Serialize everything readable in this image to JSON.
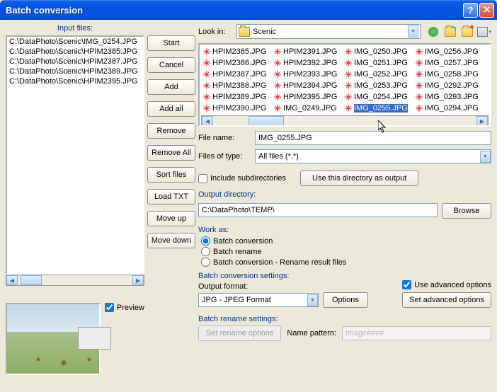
{
  "title": "Batch conversion",
  "input_files_label": "Input files:",
  "input_files": [
    "C:\\DataPhoto\\Scenic\\IMG_0254.JPG",
    "C:\\DataPhoto\\Scenic\\HPIM2385.JPG",
    "C:\\DataPhoto\\Scenic\\HPIM2387.JPG",
    "C:\\DataPhoto\\Scenic\\HPIM2389.JPG",
    "C:\\DataPhoto\\Scenic\\HPIM2395.JPG"
  ],
  "preview_label": "Preview",
  "buttons": {
    "start": "Start",
    "cancel": "Cancel",
    "add": "Add",
    "add_all": "Add all",
    "remove": "Remove",
    "remove_all": "Remove All",
    "sort": "Sort files",
    "load_txt": "Load TXT",
    "move_up": "Move up",
    "move_down": "Move down"
  },
  "lookin_label": "Look in:",
  "lookin_value": "Scenic",
  "file_list": [
    "HPIM2385.JPG",
    "HPIM2386.JPG",
    "HPIM2387.JPG",
    "HPIM2388.JPG",
    "HPIM2389.JPG",
    "HPIM2390.JPG",
    "HPIM2391.JPG",
    "HPIM2392.JPG",
    "HPIM2393.JPG",
    "HPIM2394.JPG",
    "HPIM2395.JPG",
    "IMG_0249.JPG",
    "IMG_0250.JPG",
    "IMG_0251.JPG",
    "IMG_0252.JPG",
    "IMG_0253.JPG",
    "IMG_0254.JPG",
    "IMG_0255.JPG",
    "IMG_0256.JPG",
    "IMG_0257.JPG",
    "IMG_0258.JPG",
    "IMG_0292.JPG",
    "IMG_0293.JPG",
    "IMG_0294.JPG"
  ],
  "selected_file_index": 17,
  "filename_label": "File name:",
  "filename_value": "IMG_0255.JPG",
  "filetype_label": "Files of type:",
  "filetype_value": "All files (*.*)",
  "include_sub": "Include subdirectories",
  "use_dir_btn": "Use this directory as output",
  "outdir_label": "Output directory:",
  "outdir_value": "C:\\DataPhoto\\TEMP\\",
  "browse_btn": "Browse",
  "work_label": "Work as:",
  "work_options": [
    "Batch conversion",
    "Batch rename",
    "Batch conversion - Rename result files"
  ],
  "bc_settings_label": "Batch conversion settings:",
  "output_format_label": "Output format:",
  "output_format_value": "JPG - JPEG Format",
  "options_btn": "Options",
  "adv_chk": "Use advanced options",
  "adv_btn": "Set advanced options",
  "rename_label": "Batch rename settings:",
  "rename_btn": "Set rename options",
  "name_pattern_label": "Name pattern:",
  "name_pattern_placeholder": "image####"
}
